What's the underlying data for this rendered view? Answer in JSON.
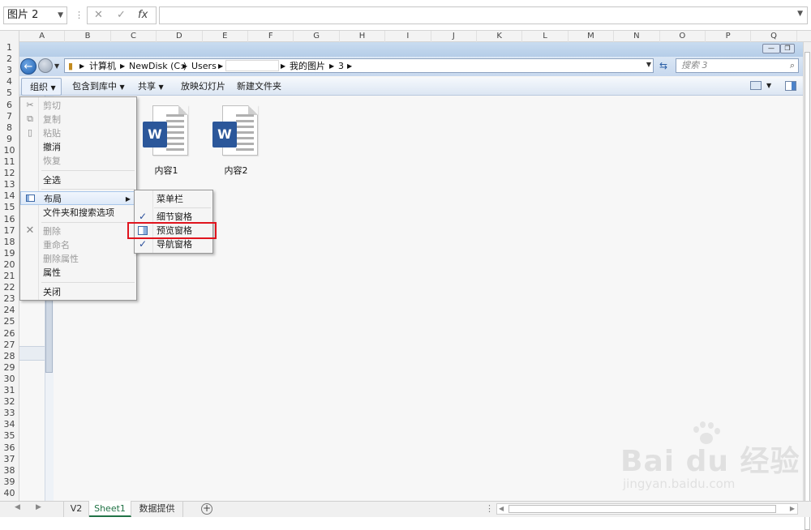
{
  "excel": {
    "name_box": "图片 2",
    "formula_value": "",
    "columns": [
      "A",
      "B",
      "C",
      "D",
      "E",
      "F",
      "G",
      "H",
      "I",
      "J",
      "K",
      "L",
      "M",
      "N",
      "O",
      "P",
      "Q"
    ],
    "rows": [
      "1",
      "2",
      "3",
      "4",
      "5",
      "6",
      "7",
      "8",
      "9",
      "10",
      "11",
      "12",
      "13",
      "14",
      "15",
      "16",
      "17",
      "18",
      "19",
      "20",
      "21",
      "22",
      "23",
      "24",
      "25",
      "26",
      "27",
      "28",
      "29",
      "30",
      "31",
      "32",
      "33",
      "34",
      "35",
      "36",
      "37",
      "38",
      "39",
      "40"
    ],
    "sheet_tabs": [
      "V2",
      "Sheet1",
      "数据提供"
    ],
    "active_tab": "Sheet1"
  },
  "explorer": {
    "breadcrumb": [
      "计算机",
      "NewDisk (C:)",
      "Users",
      "",
      "我的图片",
      "3"
    ],
    "search_placeholder": "搜索 3",
    "toolbar": [
      "组织",
      "包含到库中",
      "共享",
      "放映幻灯片",
      "新建文件夹"
    ],
    "files": [
      {
        "name": "内容1",
        "badge": "W"
      },
      {
        "name": "内容2",
        "badge": "W"
      }
    ]
  },
  "organize_menu": {
    "items": [
      {
        "label": "剪切",
        "disabled": true,
        "icon": "scissors-icon"
      },
      {
        "label": "复制",
        "disabled": true,
        "icon": "copy-icon"
      },
      {
        "label": "粘贴",
        "disabled": true,
        "icon": "paste-icon"
      },
      {
        "label": "撤消",
        "disabled": false,
        "icon": ""
      },
      {
        "label": "恢复",
        "disabled": true,
        "icon": ""
      },
      {
        "label": "全选",
        "disabled": false,
        "icon": ""
      },
      {
        "label": "布局",
        "disabled": false,
        "icon": "layout-icon",
        "submenu": true
      },
      {
        "label": "文件夹和搜索选项",
        "disabled": false,
        "icon": ""
      },
      {
        "label": "删除",
        "disabled": true,
        "icon": "delete-x-icon"
      },
      {
        "label": "重命名",
        "disabled": true,
        "icon": ""
      },
      {
        "label": "删除属性",
        "disabled": true,
        "icon": ""
      },
      {
        "label": "属性",
        "disabled": false,
        "icon": ""
      },
      {
        "label": "关闭",
        "disabled": false,
        "icon": ""
      }
    ]
  },
  "layout_submenu": {
    "items": [
      {
        "label": "菜单栏",
        "checked": false
      },
      {
        "label": "细节窗格",
        "checked": true
      },
      {
        "label": "预览窗格",
        "checked": false,
        "highlighted": true
      },
      {
        "label": "导航窗格",
        "checked": true
      }
    ]
  },
  "watermark": {
    "brand": "Bai du 经验",
    "url": "jingyan.baidu.com"
  }
}
